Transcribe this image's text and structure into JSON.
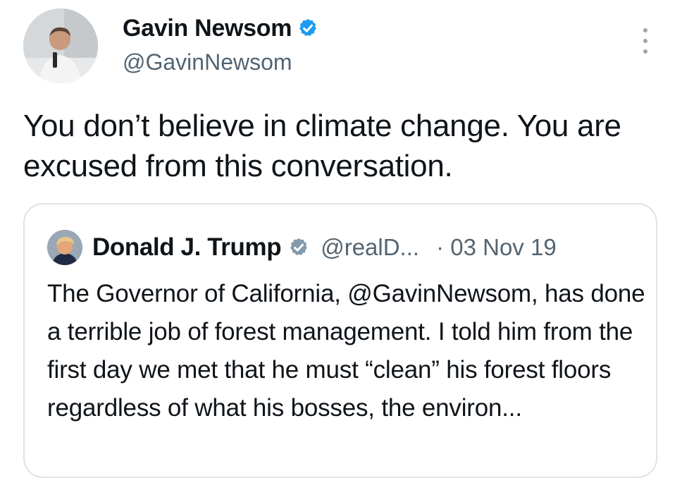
{
  "tweet": {
    "author": {
      "display_name": "Gavin Newsom",
      "handle": "@GavinNewsom",
      "verified": true,
      "avatar": "gavin-newsom-avatar"
    },
    "text": "You don’t believe in climate change. You are excused from this conversation.",
    "more_icon": "three-dots-vertical-icon"
  },
  "quoted_tweet": {
    "author": {
      "display_name": "Donald J. Trump",
      "handle": "@realD...",
      "verified": true,
      "verified_color": "#829aab",
      "avatar": "donald-trump-avatar"
    },
    "date": "· 03 Nov 19",
    "text": "The Governor of California, @GavinNewsom, has done a terrible job of forest management. I told him from the first day we met that he must “clean” his forest floors regardless of what his bosses, the environ..."
  },
  "colors": {
    "text_primary": "#0f1419",
    "text_secondary": "#536471",
    "verified_blue": "#1d9bf0",
    "card_border": "#dfe3e6"
  }
}
